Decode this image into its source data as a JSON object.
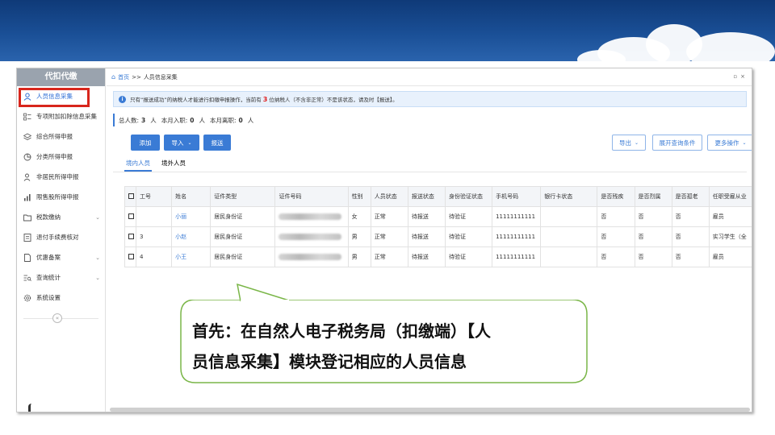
{
  "sidebar": {
    "title": "代扣代缴",
    "items": [
      {
        "label": "人员信息采集",
        "icon": "person-icon",
        "active": true
      },
      {
        "label": "专项附加扣除信息采集",
        "icon": "list-icon"
      },
      {
        "label": "综合所得申报",
        "icon": "layers-icon"
      },
      {
        "label": "分类所得申报",
        "icon": "pie-icon"
      },
      {
        "label": "非居民所得申报",
        "icon": "user-outline-icon"
      },
      {
        "label": "限售股所得申报",
        "icon": "bar-chart-icon"
      },
      {
        "label": "税款缴纳",
        "icon": "folder-icon",
        "expandable": true
      },
      {
        "label": "退付手续费核对",
        "icon": "receipt-icon"
      },
      {
        "label": "优惠备案",
        "icon": "document-icon",
        "expandable": true
      },
      {
        "label": "查询统计",
        "icon": "search-list-icon",
        "expandable": true
      },
      {
        "label": "系统设置",
        "icon": "gear-icon"
      }
    ]
  },
  "topbar": {
    "home": "首页",
    "separator": ">>",
    "current": "人员信息采集"
  },
  "notice": {
    "prefix": "只有“报送成功”的纳税人才能进行扣缴申报操作，当前有",
    "count": "3",
    "suffix": "位纳税人（不含非正常）不是该状态，请及时【报送】。"
  },
  "stats": {
    "total_label": "总人数:",
    "total_value": "3",
    "total_unit": "人",
    "joined_label": "本月入职:",
    "joined_value": "0",
    "joined_unit": "人",
    "left_label": "本月离职:",
    "left_value": "0",
    "left_unit": "人"
  },
  "toolbar": {
    "add": "添加",
    "import": "导入",
    "submit": "报送",
    "export": "导出",
    "expand_query": "展开查询条件",
    "more_actions": "更多操作"
  },
  "tabs": {
    "domestic": "境内人员",
    "foreign": "境外人员"
  },
  "table": {
    "headers": [
      "",
      "工号",
      "姓名",
      "证件类型",
      "证件号码",
      "性别",
      "人员状态",
      "报送状态",
      "身份验证状态",
      "手机号码",
      "银行卡状态",
      "是否残疾",
      "是否烈属",
      "是否孤老",
      "任职受雇从业"
    ],
    "rows": [
      {
        "id": "",
        "name": "小丽",
        "id_type": "居民身份证",
        "gender": "女",
        "status": "正常",
        "submit_status": "待报送",
        "verify_status": "待验证",
        "phone": "11111111111",
        "bank": "",
        "disabled": "否",
        "martyr": "否",
        "elderly": "否",
        "employment": "雇员"
      },
      {
        "id": "3",
        "name": "小赵",
        "id_type": "居民身份证",
        "gender": "男",
        "status": "正常",
        "submit_status": "待报送",
        "verify_status": "待验证",
        "phone": "11111111111",
        "bank": "",
        "disabled": "否",
        "martyr": "否",
        "elderly": "否",
        "employment": "实习学生（全"
      },
      {
        "id": "4",
        "name": "小王",
        "id_type": "居民身份证",
        "gender": "男",
        "status": "正常",
        "submit_status": "待报送",
        "verify_status": "待验证",
        "phone": "11111111111",
        "bank": "",
        "disabled": "否",
        "martyr": "否",
        "elderly": "否",
        "employment": "雇员"
      }
    ]
  },
  "callout": {
    "line1": "首先：在自然人电子税务局（扣缴端）【人",
    "line2": "员信息采集】模块登记相应的人员信息"
  },
  "colors": {
    "accent": "#3a7bd5",
    "highlight_box": "#d8261c",
    "callout_border": "#7ab648",
    "banner": "#1a4f96"
  }
}
